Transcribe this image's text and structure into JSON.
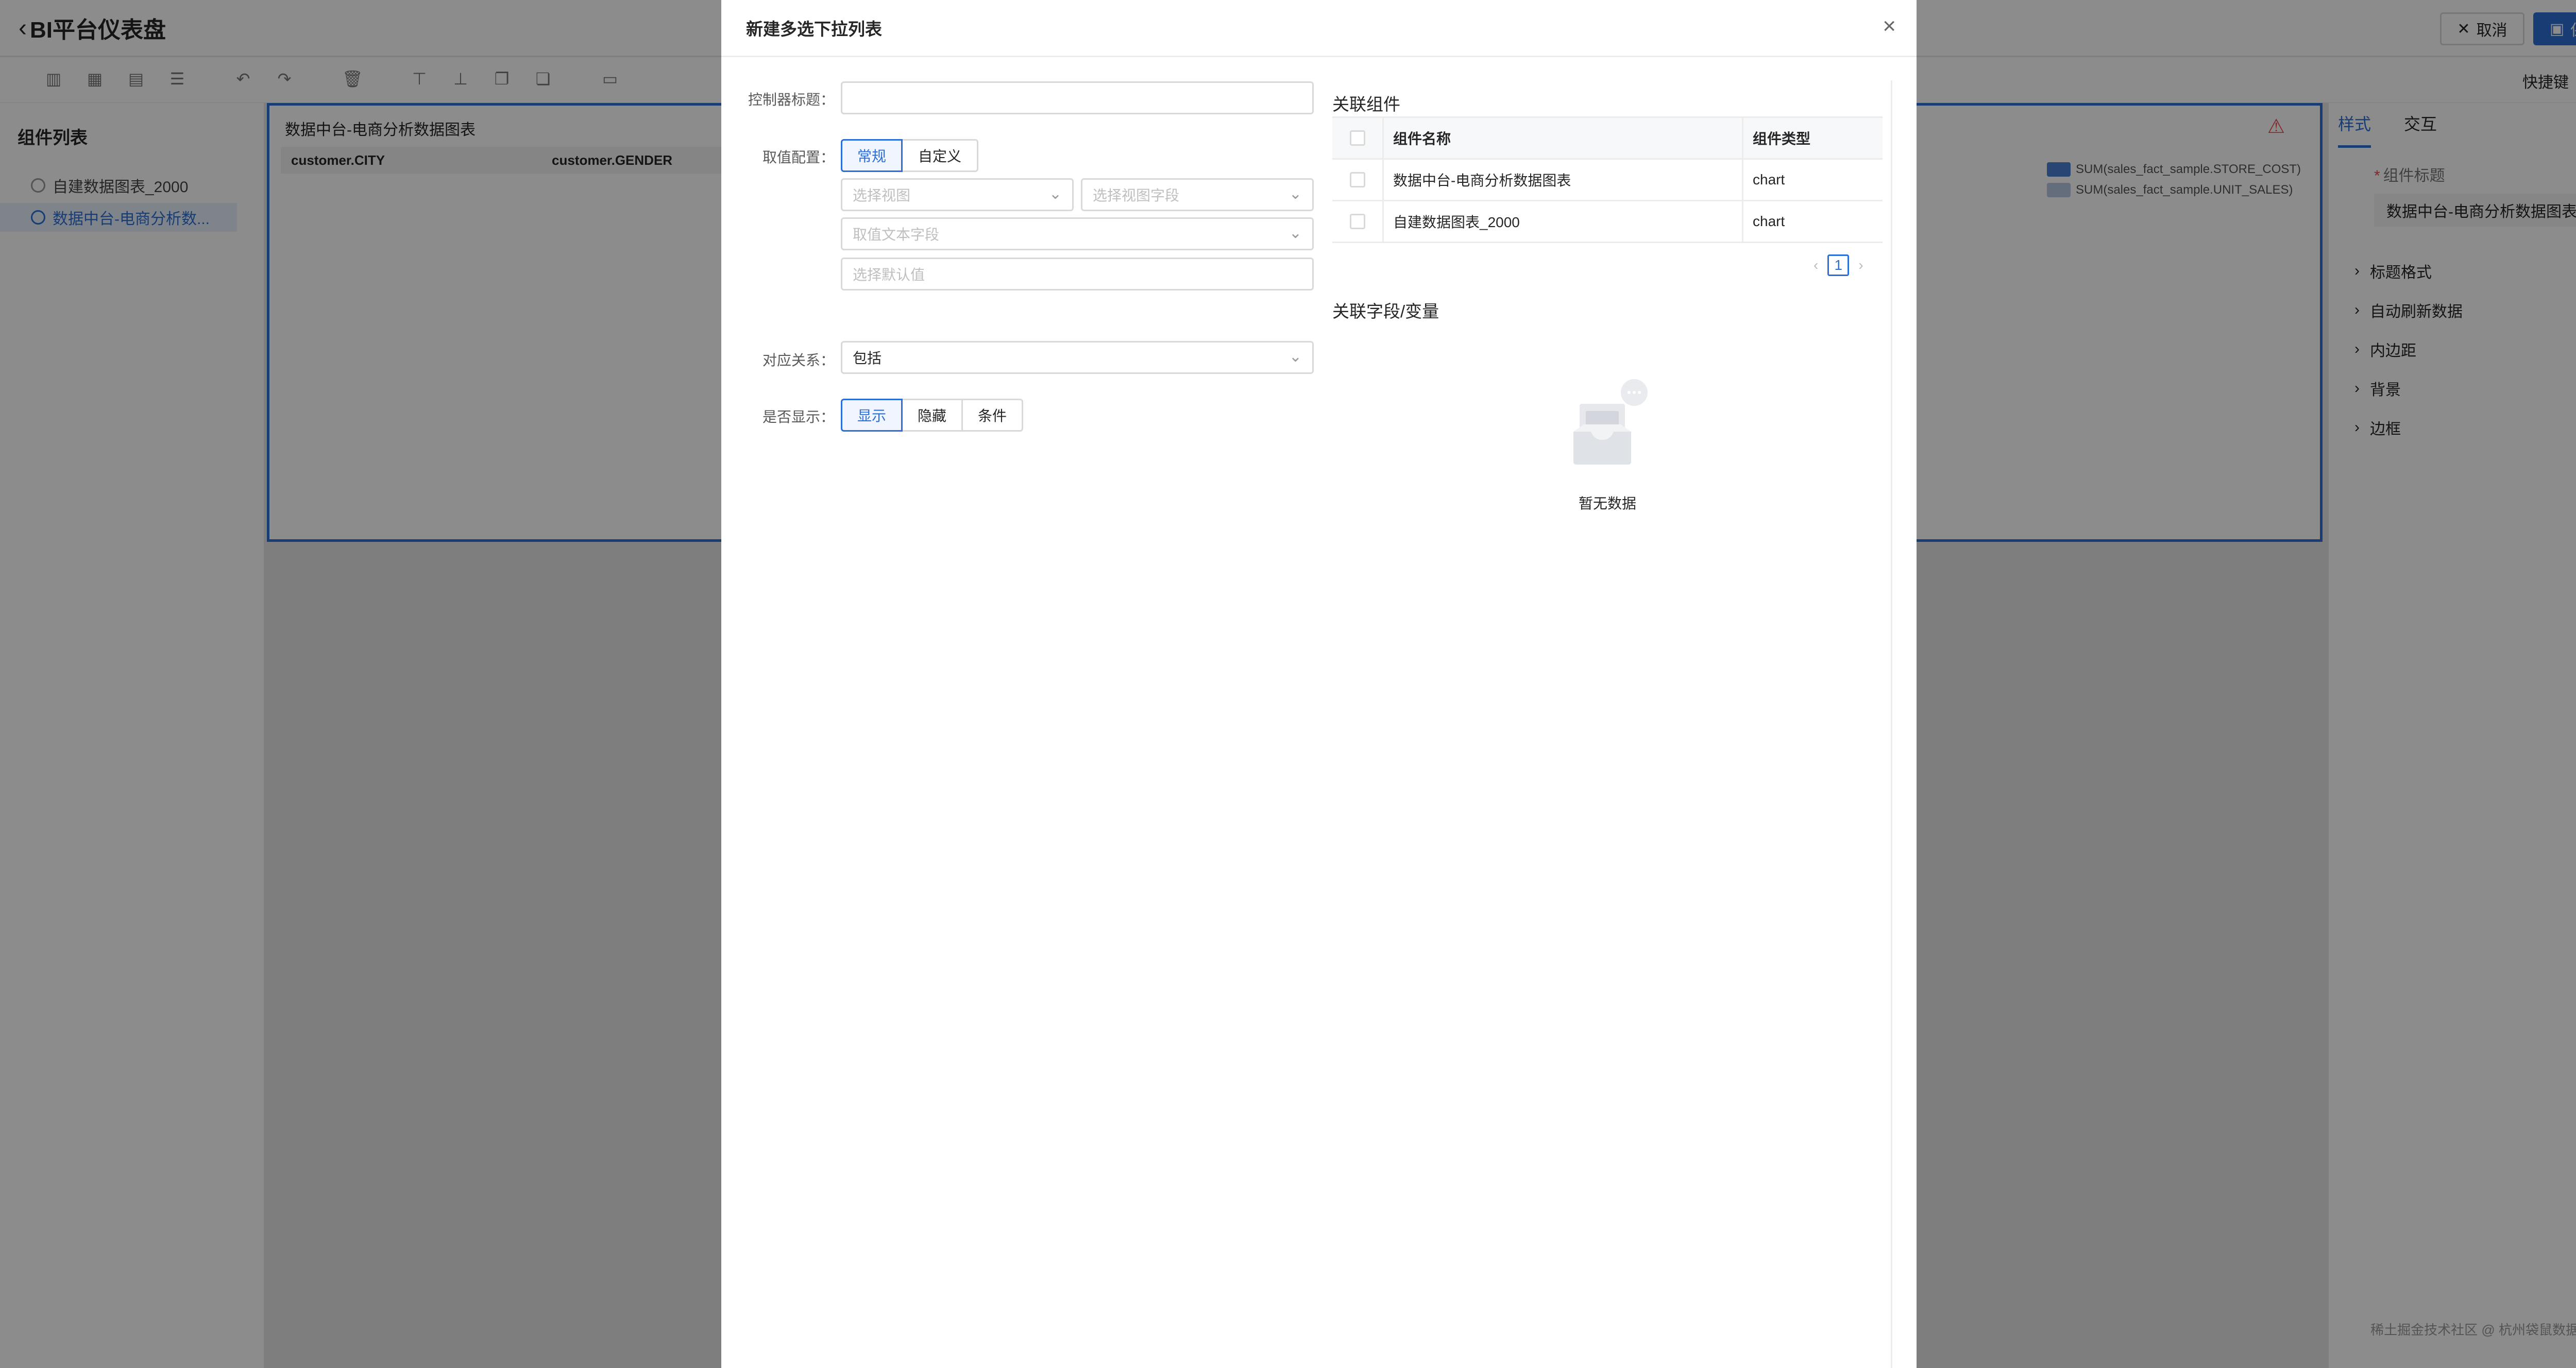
{
  "app": {
    "title": "BI平台仪表盘",
    "cancel_label": "取消",
    "save_label": "保存",
    "shortcut_label": "快捷键"
  },
  "left_panel": {
    "title": "组件列表",
    "items": [
      {
        "label": "自建数据图表_2000",
        "active": false
      },
      {
        "label": "数据中台-电商分析数...",
        "active": true
      }
    ]
  },
  "canvas": {
    "widget_title": "数据中台-电商分析数据图表",
    "table_headers": [
      "customer.CITY",
      "customer.GENDER"
    ],
    "legend": [
      {
        "label": "SUM(sales_fact_sample.STORE_COST)",
        "color": "#4a7fd4"
      },
      {
        "label": "SUM(sales_fact_sample.UNIT_SALES)",
        "color": "#b7c7e2"
      }
    ]
  },
  "right_panel": {
    "tabs": [
      "样式",
      "交互"
    ],
    "active_tab": "样式",
    "title_label": "组件标题",
    "title_value": "数据中台-电商分析数据图表",
    "sections": [
      "标题格式",
      "自动刷新数据",
      "内边距",
      "背景",
      "边框"
    ]
  },
  "modal": {
    "title": "新建多选下拉列表",
    "form": {
      "title_label": "控制器标题",
      "title_value": "",
      "value_config_label": "取值配置",
      "value_config_options": [
        "常规",
        "自定义"
      ],
      "value_config_selected": "常规",
      "view_placeholder": "选择视图",
      "view_field_placeholder": "选择视图字段",
      "text_field_placeholder": "取值文本字段",
      "default_placeholder": "选择默认值",
      "relation_label": "对应关系",
      "relation_value": "包括",
      "display_label": "是否显示",
      "display_options": [
        "显示",
        "隐藏",
        "条件"
      ],
      "display_selected": "显示"
    },
    "linked": {
      "title": "关联组件",
      "col_name": "组件名称",
      "col_type": "组件类型",
      "rows": [
        {
          "name": "数据中台-电商分析数据图表",
          "type": "chart"
        },
        {
          "name": "自建数据图表_2000",
          "type": "chart"
        }
      ],
      "page": "1"
    },
    "fields": {
      "title": "关联字段/变量",
      "empty_text": "暂无数据"
    }
  },
  "watermark": "稀土掘金技术社区 @ 杭州袋鼠数据科技",
  "colors": {
    "accent": "#2c6fd6",
    "warning": "#e84a4a",
    "mask": "rgba(0,0,0,0.45)"
  }
}
